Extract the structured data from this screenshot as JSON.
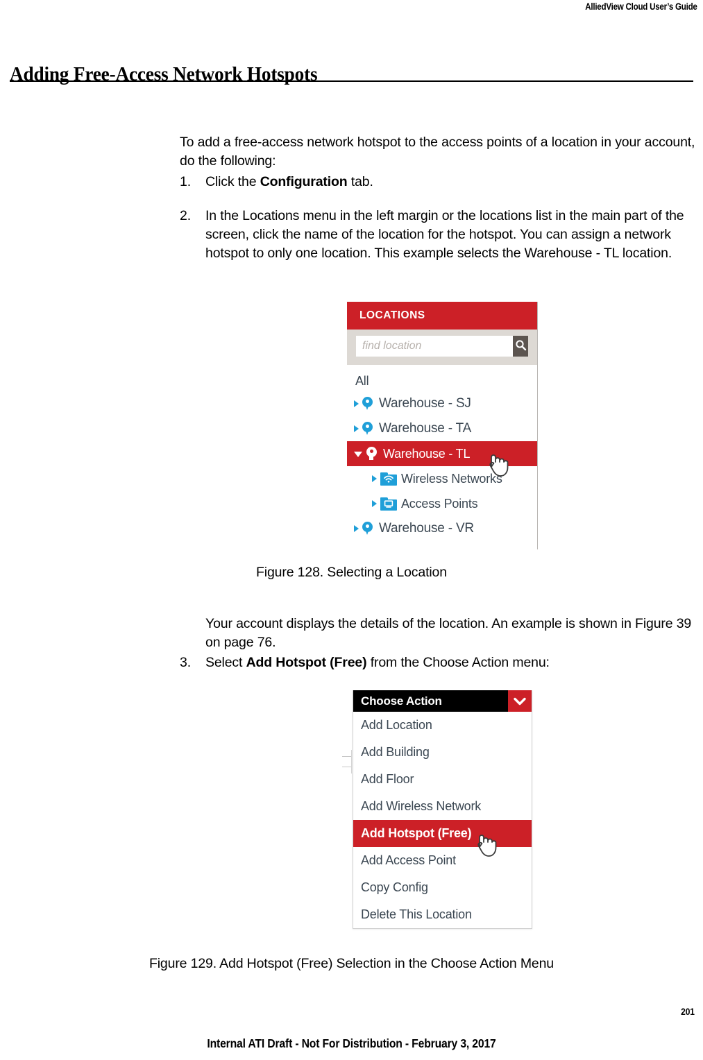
{
  "header": {
    "running_head": "AlliedView Cloud User’s Guide"
  },
  "page": {
    "chapter_title": "Adding Free-Access Network Hotspots",
    "page_number": "201",
    "footer_note": "Internal ATI Draft - Not For Distribution - February 3, 2017"
  },
  "body": {
    "intro": "To add a free-access network hotspot to the access points of a location in your account, do the following:",
    "step1": {
      "number": "1.",
      "prefix": "Click the ",
      "bold": "Configuration",
      "suffix": " tab."
    },
    "step2": {
      "number": "2.",
      "text": "In the Locations menu in the left margin or the locations list in the main part of the screen, click the name of the location for the hotspot. You can assign a network hotspot to only one location. This example selects the Warehouse - TL location."
    },
    "note": "Your account displays the details of the location. An example is shown in Figure 39 on page 76.",
    "step3": {
      "number": "3.",
      "prefix": "Select ",
      "bold": "Add Hotspot (Free)",
      "suffix": " from the Choose Action menu:"
    }
  },
  "figures": {
    "fig128_caption": "Figure 128. Selecting a Location",
    "fig129_caption": "Figure 129. Add Hotspot (Free) Selection in the Choose Action Menu"
  },
  "locations_panel": {
    "title": "LOCATIONS",
    "search_placeholder": "find location",
    "search_value": "",
    "tree": {
      "root_label": "All",
      "items": [
        {
          "label": "Warehouse - SJ",
          "icon": "map-pin-icon",
          "expanded": false,
          "selected": false
        },
        {
          "label": "Warehouse - TA",
          "icon": "map-pin-icon",
          "expanded": false,
          "selected": false
        },
        {
          "label": "Warehouse - TL",
          "icon": "map-pin-icon",
          "expanded": true,
          "selected": true
        },
        {
          "label": "Wireless Networks",
          "icon": "wifi-folder-icon",
          "expanded": false,
          "selected": false,
          "child": true
        },
        {
          "label": "Access Points",
          "icon": "monitor-folder-icon",
          "expanded": false,
          "selected": false,
          "child": true
        },
        {
          "label": "Warehouse - VR",
          "icon": "map-pin-icon",
          "expanded": false,
          "selected": false
        }
      ]
    }
  },
  "action_menu": {
    "header_label": "Choose Action",
    "caret_icon": "chevron-down-icon",
    "items": [
      {
        "label": "Add Location",
        "highlighted": false
      },
      {
        "label": "Add Building",
        "highlighted": false
      },
      {
        "label": "Add Floor",
        "highlighted": false
      },
      {
        "label": "Add Wireless Network",
        "highlighted": false
      },
      {
        "label": "Add Hotspot (Free)",
        "highlighted": true
      },
      {
        "label": "Add Access Point",
        "highlighted": false
      },
      {
        "label": "Copy Config",
        "highlighted": false
      },
      {
        "label": "Delete This Location",
        "highlighted": false
      }
    ]
  },
  "colors": {
    "brand_red": "#cc2027",
    "accent_blue": "#1f9fd8",
    "search_bar_bg": "#ddd9d4",
    "search_button": "#5c5550",
    "menu_header_bg": "#000000"
  }
}
